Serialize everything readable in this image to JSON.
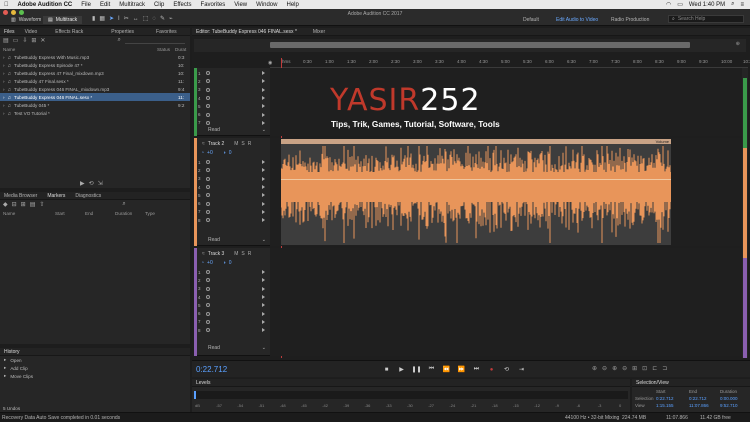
{
  "menubar": {
    "apple": "",
    "app": "Adobe Audition CC",
    "items": [
      "File",
      "Edit",
      "Multitrack",
      "Clip",
      "Effects",
      "Favorites",
      "View",
      "Window",
      "Help"
    ],
    "time": "Wed 1:40 PM"
  },
  "window": {
    "title": "Adobe Audition CC 2017"
  },
  "toolbar": {
    "waveform": "Waveform",
    "multitrack": "Multitrack"
  },
  "workspaces": [
    "Default",
    "Edit Audio to Video",
    "Radio Production"
  ],
  "search": {
    "placeholder": "Search Help"
  },
  "files": {
    "tabs": [
      "Files",
      "Video",
      "Effects Rack",
      "Properties",
      "Favorites"
    ],
    "columns": {
      "name": "Name",
      "status": "Status",
      "duration": "Durat"
    },
    "items": [
      {
        "name": "TubeBuddy Express With Music.mp3",
        "dur": "0:3"
      },
      {
        "name": "TubeBuddy Express Episode 47 *",
        "dur": "10:"
      },
      {
        "name": "TubeBuddy Express 47 Final_mixdown.mp3",
        "dur": "10:"
      },
      {
        "name": "TubeBuddy 47 Final.sesx *",
        "dur": "11:"
      },
      {
        "name": "TubeBuddy Express 046 FINAL_mixdown.mp3",
        "dur": "9:4"
      },
      {
        "name": "TubeBuddy Express 046 FINAL.sesx *",
        "dur": "11:"
      },
      {
        "name": "TubeBuddy 045 *",
        "dur": "9:2"
      },
      {
        "name": "Test VO Tutorial *",
        "dur": ""
      }
    ]
  },
  "markers": {
    "tabs": [
      "Media Browser",
      "Markers",
      "Diagnostics"
    ],
    "columns": [
      "Name",
      "Start",
      "End",
      "Duration",
      "Type"
    ]
  },
  "history": {
    "title": "History",
    "items": [
      "Open",
      "Add Clip",
      "Move Clips"
    ],
    "undos": "5 Undos",
    "status": "Recovery Data Auto Save completed in 0.01 seconds"
  },
  "editor": {
    "tab": "Editor: TubeBuddy Express 046 FINAL.sesx *",
    "mixer": "Mixer",
    "ruler_unit": "hms",
    "ruler": [
      "0:30",
      "1:00",
      "1:30",
      "2:00",
      "2:30",
      "3:00",
      "3:30",
      "4:00",
      "4:30",
      "5:00",
      "5:30",
      "6:00",
      "6:30",
      "7:00",
      "7:30",
      "8:00",
      "8:30",
      "9:00",
      "9:30",
      "10:00",
      "10:30",
      "11:00"
    ],
    "timecode": "0:22.712"
  },
  "tracks": [
    {
      "name": "",
      "read": "Read"
    },
    {
      "name": "Track 2",
      "vol": "+0",
      "pan": "0",
      "read": "Read",
      "m": "M",
      "s": "S",
      "r": "R"
    },
    {
      "name": "Track 3",
      "vol": "+0",
      "pan": "0",
      "read": "Read",
      "m": "M",
      "s": "S",
      "r": "R"
    }
  ],
  "slot_numbers": [
    "1",
    "2",
    "3",
    "4",
    "5",
    "6",
    "7",
    "8"
  ],
  "overlay": {
    "brand": "YASIR",
    "brand_num": "252",
    "tagline": "Tips, Trik, Games, Tutorial, Software, Tools"
  },
  "clip": {
    "label": "Volume"
  },
  "levels": {
    "title": "Levels",
    "ticks": [
      "dB",
      "-57",
      "-54",
      "-51",
      "-48",
      "-45",
      "-42",
      "-39",
      "-36",
      "-33",
      "-30",
      "-27",
      "-24",
      "-21",
      "-18",
      "-15",
      "-12",
      "-9",
      "-6",
      "-3",
      "0"
    ]
  },
  "selection_view": {
    "title": "Selection/View",
    "headers": [
      "Start",
      "End",
      "Duration"
    ],
    "rows": [
      {
        "label": "Selection",
        "start": "0:22.712",
        "end": "0:22.712",
        "dur": "0:00.000"
      },
      {
        "label": "View",
        "start": "1:15.155",
        "end": "11:07.866",
        "dur": "9:52.710"
      }
    ]
  },
  "statusbar": {
    "format": "44100 Hz • 32-bit Mixing",
    "mem": "224.74 MB",
    "dur": "11:07.866",
    "free": "11.42 GB free"
  },
  "colors": {
    "accent": "#2d8ceb",
    "waveform": "#e8955a",
    "track2": "#e8955a",
    "track1": "#3a9a4a",
    "track3": "#8a5fb0",
    "brand_red": "#c0392b"
  }
}
